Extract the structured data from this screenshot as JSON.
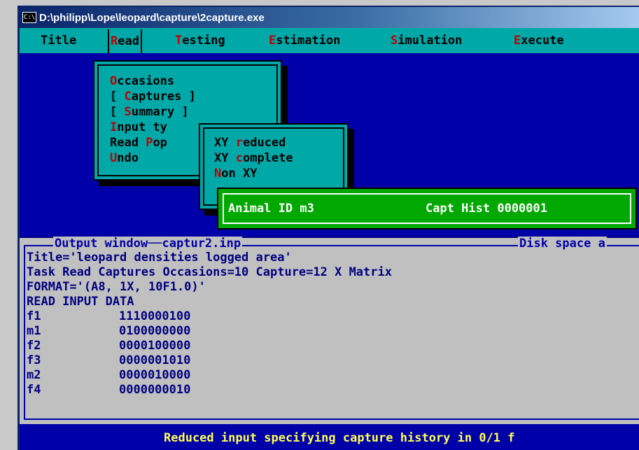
{
  "window": {
    "title": "D:\\philipp\\Lope\\leopard\\capture\\2capture.exe",
    "icon": "console-icon"
  },
  "menubar": {
    "items": [
      {
        "pre": "",
        "hk": "",
        "rest": "Title"
      },
      {
        "pre": "",
        "hk": "R",
        "rest": "ead"
      },
      {
        "pre": "",
        "hk": "T",
        "rest": "esting"
      },
      {
        "pre": "",
        "hk": "E",
        "rest": "stimation"
      },
      {
        "pre": "",
        "hk": "S",
        "rest": "imulation"
      },
      {
        "pre": "",
        "hk": "E",
        "rest": "xecute"
      }
    ]
  },
  "read_menu": {
    "items": [
      {
        "pre": "",
        "hk": "O",
        "rest": "ccasions"
      },
      {
        "pre": "[ ",
        "hk": "C",
        "rest": "aptures ]"
      },
      {
        "pre": "[ ",
        "hk": "S",
        "rest": "ummary ]"
      },
      {
        "pre": "",
        "hk": "I",
        "rest": "nput ty"
      },
      {
        "pre": "Read ",
        "hk": "P",
        "rest": "op"
      },
      {
        "pre": "",
        "hk": "U",
        "rest": "ndo"
      }
    ]
  },
  "input_type_submenu": {
    "items": [
      {
        "pre": "XY ",
        "hk": "r",
        "rest": "educed"
      },
      {
        "pre": "XY ",
        "hk": "c",
        "rest": "omplete"
      },
      {
        "pre": "",
        "hk": "N",
        "rest": "on XY"
      }
    ]
  },
  "info_box": {
    "animal_label": "Animal ID m3",
    "capt_label": "Capt Hist 0000001"
  },
  "output_window": {
    "title": "Output window──captur2.inp",
    "disk_label": "Disk space a",
    "lines": [
      "Title='leopard densities logged area'",
      "Task Read Captures Occasions=10 Capture=12 X Matrix",
      "FORMAT='(A8, 1X, 10F1.0)'",
      "READ INPUT DATA"
    ],
    "rows": [
      {
        "id": "f1",
        "hist": "1110000100"
      },
      {
        "id": "m1",
        "hist": "0100000000"
      },
      {
        "id": "f2",
        "hist": "0000100000"
      },
      {
        "id": "f3",
        "hist": "0000001010"
      },
      {
        "id": "m2",
        "hist": "0000010000"
      },
      {
        "id": "f4",
        "hist": "0000000010"
      }
    ]
  },
  "statusbar": {
    "text": "Reduced input specifying capture history in 0/1 f"
  },
  "colors": {
    "desktop_blue": "#0000a8",
    "menu_cyan": "#00a8a8",
    "hotkey_red": "#c00000",
    "info_green": "#00a800",
    "output_gray": "#c0c0c0",
    "status_yellow": "#ffff54"
  }
}
